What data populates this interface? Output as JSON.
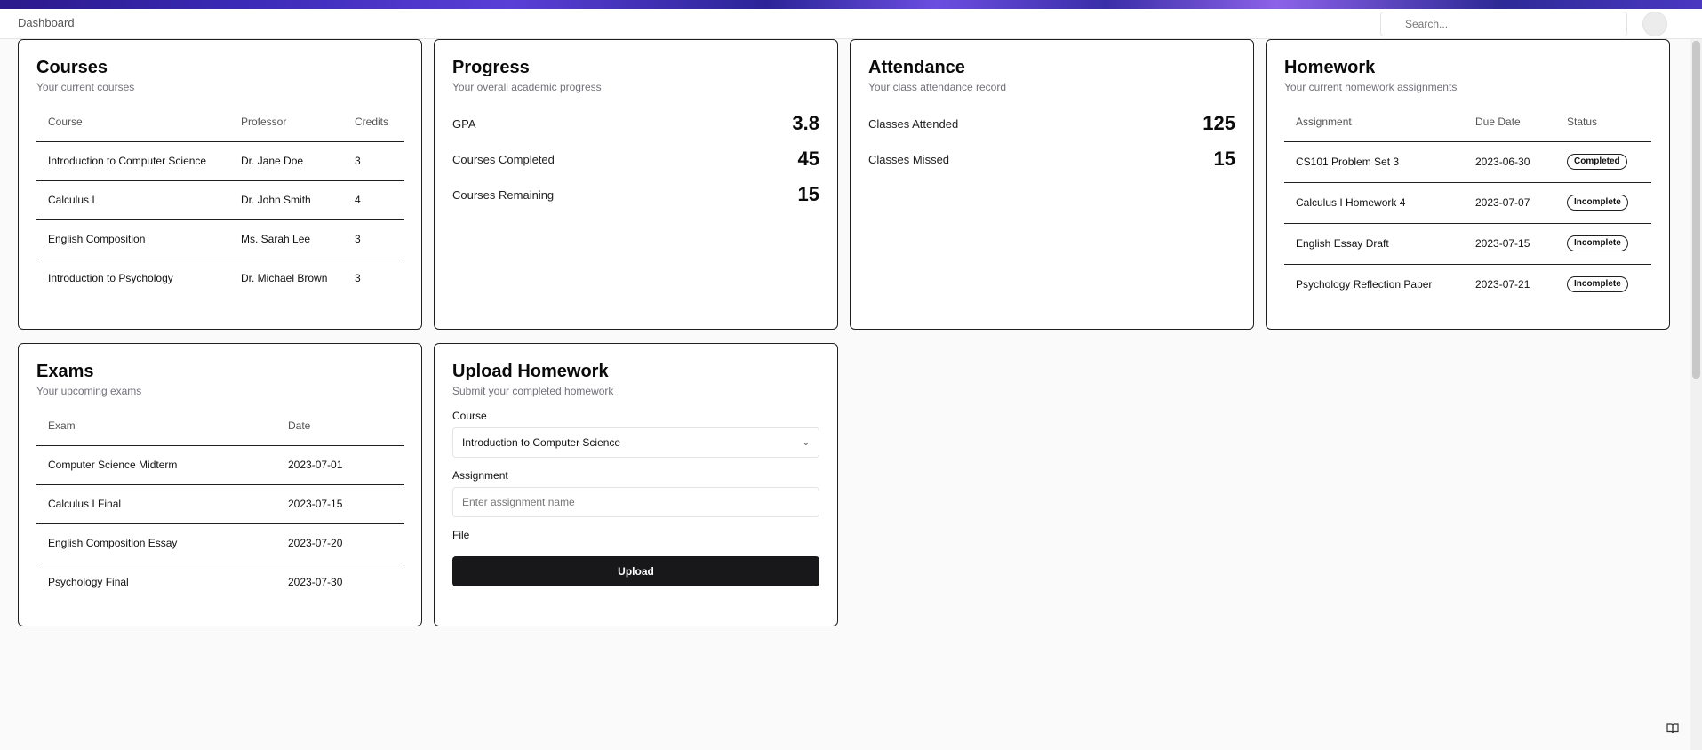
{
  "header": {
    "breadcrumb": "Dashboard",
    "search_placeholder": "Search..."
  },
  "courses": {
    "title": "Courses",
    "subtitle": "Your current courses",
    "columns": [
      "Course",
      "Professor",
      "Credits"
    ],
    "rows": [
      [
        "Introduction to Computer Science",
        "Dr. Jane Doe",
        "3"
      ],
      [
        "Calculus I",
        "Dr. John Smith",
        "4"
      ],
      [
        "English Composition",
        "Ms. Sarah Lee",
        "3"
      ],
      [
        "Introduction to Psychology",
        "Dr. Michael Brown",
        "3"
      ]
    ]
  },
  "progress": {
    "title": "Progress",
    "subtitle": "Your overall academic progress",
    "stats": [
      {
        "label": "GPA",
        "value": "3.8"
      },
      {
        "label": "Courses Completed",
        "value": "45"
      },
      {
        "label": "Courses Remaining",
        "value": "15"
      }
    ]
  },
  "attendance": {
    "title": "Attendance",
    "subtitle": "Your class attendance record",
    "stats": [
      {
        "label": "Classes Attended",
        "value": "125"
      },
      {
        "label": "Classes Missed",
        "value": "15"
      }
    ]
  },
  "homework": {
    "title": "Homework",
    "subtitle": "Your current homework assignments",
    "columns": [
      "Assignment",
      "Due Date",
      "Status"
    ],
    "rows": [
      [
        "CS101 Problem Set 3",
        "2023-06-30",
        "Completed"
      ],
      [
        "Calculus I Homework 4",
        "2023-07-07",
        "Incomplete"
      ],
      [
        "English Essay Draft",
        "2023-07-15",
        "Incomplete"
      ],
      [
        "Psychology Reflection Paper",
        "2023-07-21",
        "Incomplete"
      ]
    ]
  },
  "exams": {
    "title": "Exams",
    "subtitle": "Your upcoming exams",
    "columns": [
      "Exam",
      "Date"
    ],
    "rows": [
      [
        "Computer Science Midterm",
        "2023-07-01"
      ],
      [
        "Calculus I Final",
        "2023-07-15"
      ],
      [
        "English Composition Essay",
        "2023-07-20"
      ],
      [
        "Psychology Final",
        "2023-07-30"
      ]
    ]
  },
  "upload": {
    "title": "Upload Homework",
    "subtitle": "Submit your completed homework",
    "course_label": "Course",
    "course_value": "Introduction to Computer Science",
    "assignment_label": "Assignment",
    "assignment_placeholder": "Enter assignment name",
    "file_label": "File",
    "upload_button": "Upload"
  },
  "icons": {
    "corner": "book-open-icon",
    "select": "chevron-down-icon"
  }
}
